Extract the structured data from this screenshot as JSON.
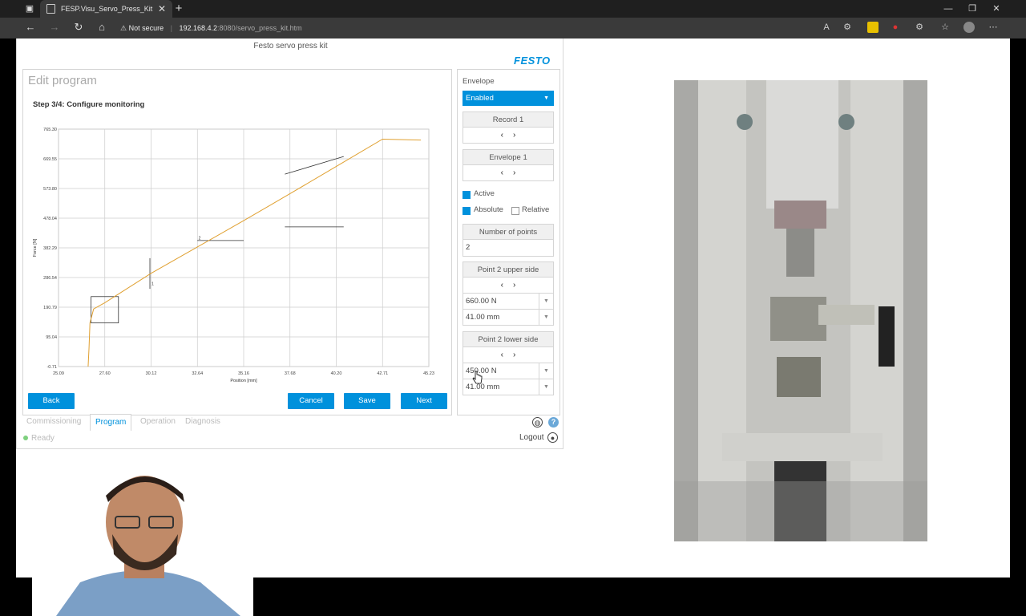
{
  "browser": {
    "tab_title": "FESP.Visu_Servo_Press_Kit",
    "security_label": "Not secure",
    "url_host": "192.168.4.2",
    "url_path": ":8080/servo_press_kit.htm"
  },
  "app": {
    "title": "Festo servo press kit",
    "brand": "FESTO",
    "brand_color": "#0091dc",
    "page_title": "Edit program",
    "step_title": "Step 3/4: Configure monitoring",
    "buttons": {
      "back": "Back",
      "cancel": "Cancel",
      "save": "Save",
      "next": "Next"
    },
    "tabs": [
      "Commissioning",
      "Program",
      "Operation",
      "Diagnosis"
    ],
    "active_tab": "Program",
    "status": "Ready",
    "logout": "Logout",
    "help_icon": "?"
  },
  "side": {
    "envelope_label": "Envelope",
    "envelope_value": "Enabled",
    "record_label": "Record 1",
    "envelope_item_label": "Envelope 1",
    "active_label": "Active",
    "absolute_label": "Absolute",
    "relative_label": "Relative",
    "num_points_label": "Number of points",
    "num_points_value": "2",
    "upper_label": "Point 2 upper side",
    "upper_force": "660.00 N",
    "upper_pos": "41.00 mm",
    "lower_label": "Point 2 lower side",
    "lower_force": "450.00 N",
    "lower_pos": "41.00 mm"
  },
  "chart_data": {
    "type": "line",
    "xlabel": "Position [mm]",
    "ylabel": "Force [N]",
    "x_ticks": [
      "25.09",
      "27.60",
      "30.12",
      "32.64",
      "35.16",
      "37.68",
      "40.20",
      "42.71",
      "45.23"
    ],
    "y_ticks": [
      "765.30",
      "669.55",
      "573.80",
      "478.04",
      "382.29",
      "286.54",
      "190.79",
      "95.04",
      "-0.71"
    ],
    "xlim": [
      25.09,
      45.23
    ],
    "ylim": [
      -0.71,
      765.3
    ],
    "grid": true,
    "series": [
      {
        "color": "#e0a030",
        "x": [
          26.7,
          26.75,
          26.8,
          27.0,
          27.6,
          30.12,
          32.64,
          35.16,
          37.68,
          40.2,
          42.71,
          44.8
        ],
        "y": [
          -0.71,
          60,
          140,
          185,
          205,
          300,
          385,
          470,
          557,
          645,
          733,
          730
        ]
      }
    ],
    "annotations": [
      "1",
      "2"
    ]
  }
}
